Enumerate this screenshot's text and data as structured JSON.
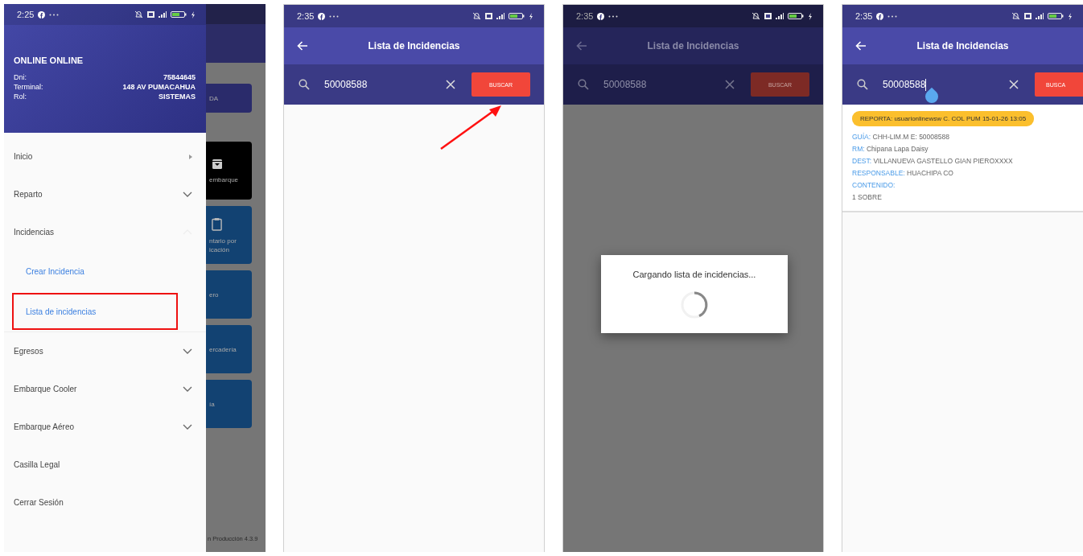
{
  "screens": [
    {
      "kind": "drawer",
      "status_bar": {
        "time": "2:25"
      },
      "profile": {
        "name": "ONLINE ONLINE",
        "fields": [
          {
            "label": "Dni:",
            "value": "75844645"
          },
          {
            "label": "Terminal:",
            "value": "148 AV PUMACAHUA"
          },
          {
            "label": "Rol:",
            "value": "SISTEMAS"
          }
        ]
      },
      "menu": [
        {
          "label": "Inicio",
          "kind": "submenu"
        },
        {
          "label": "Reparto",
          "kind": "group",
          "expanded": false
        },
        {
          "label": "Incidencias",
          "kind": "group",
          "expanded": true,
          "children": [
            {
              "label": "Crear Incidencia",
              "highlighted": false
            },
            {
              "label": "Lista de incidencias",
              "highlighted": true
            }
          ]
        },
        {
          "label": "Egresos",
          "kind": "group",
          "expanded": false
        },
        {
          "label": "Embarque Cooler",
          "kind": "group",
          "expanded": false
        },
        {
          "label": "Embarque Aéreo",
          "kind": "group",
          "expanded": false
        },
        {
          "label": "Casilla Legal",
          "kind": "link"
        },
        {
          "label": "Cerrar Sesión",
          "kind": "link"
        }
      ],
      "background": {
        "tiles": [
          {
            "kind": "bar",
            "color": "#2a2b6b",
            "texts": [
              "DA"
            ]
          },
          {
            "kind": "download",
            "color": "#000000",
            "texts": [
              "embarque"
            ]
          },
          {
            "kind": "clipboard",
            "color": "#124272",
            "texts": [
              "ntario por",
              "icación"
            ]
          },
          {
            "kind": "plain",
            "color": "#124272",
            "texts": [
              "ero"
            ]
          },
          {
            "kind": "plain",
            "color": "#124272",
            "texts": [
              "ercadería"
            ]
          },
          {
            "kind": "plain",
            "color": "#124272",
            "texts": [
              "ía"
            ]
          }
        ],
        "footer": "n Producción 4.3.9"
      }
    },
    {
      "kind": "search",
      "annotated": true,
      "status_bar": {
        "time": "2:35"
      },
      "title": "Lista de Incidencias",
      "search": {
        "value": "50008588",
        "button": "BUSCAR"
      }
    },
    {
      "kind": "search",
      "dimmed": true,
      "status_bar": {
        "time": "2:35"
      },
      "title": "Lista de Incidencias",
      "search": {
        "value": "50008588",
        "button": "BUSCAR"
      },
      "dialog": {
        "message": "Cargando lista de incidencias..."
      }
    },
    {
      "kind": "search",
      "status_bar": {
        "time": "2:35"
      },
      "title": "Lista de Incidencias",
      "search": {
        "value": "50008588",
        "button": "BUSCA",
        "focused": true
      },
      "results": [
        {
          "reporter": "REPORTA: usuarionlinewsw C. COL PUM  15-01-26 13:05",
          "fields": [
            {
              "label": "GUÍA:",
              "value": "CHH-LIM.M  E: 50008588",
              "kind": "inline"
            },
            {
              "label": "RM:",
              "value": "Chipana Lapa Daisy",
              "kind": "inline"
            },
            {
              "label": "DEST:",
              "value": "VILLANUEVA GASTELLO GIAN PIEROXXXX",
              "kind": "inline"
            },
            {
              "label": "RESPONSABLE:",
              "value": "HUACHIPA CO",
              "kind": "inline"
            },
            {
              "label": "CONTENIDO:",
              "value": "1 SOBRE",
              "kind": "block"
            }
          ]
        }
      ]
    }
  ]
}
